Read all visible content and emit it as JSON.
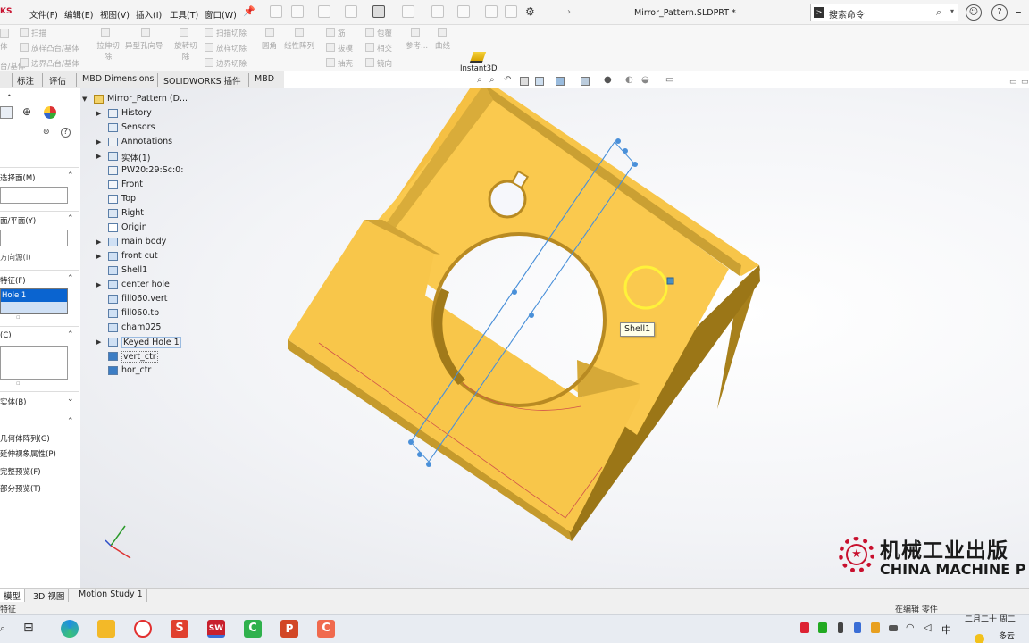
{
  "app": {
    "logo_text": "KS",
    "document_title": "Mirror_Pattern.SLDPRT *"
  },
  "menu": {
    "items": [
      "文件(F)",
      "编辑(E)",
      "视图(V)",
      "插入(I)",
      "工具(T)",
      "窗口(W)"
    ]
  },
  "search": {
    "placeholder": "搜索命令"
  },
  "ribbon": {
    "left_cut_items": [
      "扫描",
      "放样凸台/基体",
      "边界凸台/基体"
    ],
    "left_cut_labels": [
      "体",
      "台/基体"
    ],
    "cut_groups": [
      "拉伸切除",
      "异型孔向导",
      "旋转切除"
    ],
    "cut_items": [
      "扫描切除",
      "放样切除",
      "边界切除"
    ],
    "feature_groups": [
      "圆角",
      "线性阵列"
    ],
    "feature_items_a": [
      "筋",
      "拔模",
      "抽壳"
    ],
    "feature_items_b": [
      "包覆",
      "相交",
      "镜向"
    ],
    "ref_groups": [
      "参考...",
      "曲线"
    ],
    "instant3d": "Instant3D"
  },
  "command_tabs": [
    "标注",
    "评估",
    "MBD Dimensions",
    "SOLIDWORKS 插件",
    "MBD"
  ],
  "left_panel": {
    "section1": "选择面(M)",
    "section2": "面/平面(Y)",
    "direction": "方向源(I)",
    "section3": "特征(F)",
    "selected_feature": "Hole 1",
    "section4": "(C)",
    "section5": "实体(B)",
    "options": [
      "几何体阵列(G)",
      "延伸视象属性(P)",
      "完整预览(F)",
      "部分预览(T)"
    ]
  },
  "feature_tree": {
    "root": "Mirror_Pattern (D...",
    "items": [
      {
        "label": "History",
        "expandable": true
      },
      {
        "label": "Sensors",
        "expandable": false
      },
      {
        "label": "Annotations",
        "expandable": true
      },
      {
        "label": "实体(1)",
        "expandable": true
      },
      {
        "label": "PW20:29:Sc:0:",
        "expandable": false
      },
      {
        "label": "Front",
        "expandable": false
      },
      {
        "label": "Top",
        "expandable": false
      },
      {
        "label": "Right",
        "expandable": false
      },
      {
        "label": "Origin",
        "expandable": false
      },
      {
        "label": "main body",
        "expandable": true
      },
      {
        "label": "front cut",
        "expandable": true
      },
      {
        "label": "Shell1",
        "expandable": false
      },
      {
        "label": "center hole",
        "expandable": true
      },
      {
        "label": "fill060.vert",
        "expandable": false
      },
      {
        "label": "fill060.tb",
        "expandable": false
      },
      {
        "label": "cham025",
        "expandable": false
      },
      {
        "label": "Keyed Hole 1",
        "expandable": true
      },
      {
        "label": "vert_ctr",
        "expandable": false
      },
      {
        "label": "hor_ctr",
        "expandable": false
      }
    ]
  },
  "viewport": {
    "tooltip": "Shell1",
    "part_color": "#f9c84e",
    "sketch_color": "#4a90d9"
  },
  "bottom_tabs": [
    "模型",
    "3D 视图",
    "Motion Study 1"
  ],
  "status": {
    "left": "特征",
    "right": "在编辑 零件"
  },
  "watermark": {
    "cn": "机械工业出版",
    "en": "CHINA MACHINE P"
  },
  "taskbar": {
    "ime": "中",
    "date": "二月二十 周二",
    "weather": "多云"
  }
}
